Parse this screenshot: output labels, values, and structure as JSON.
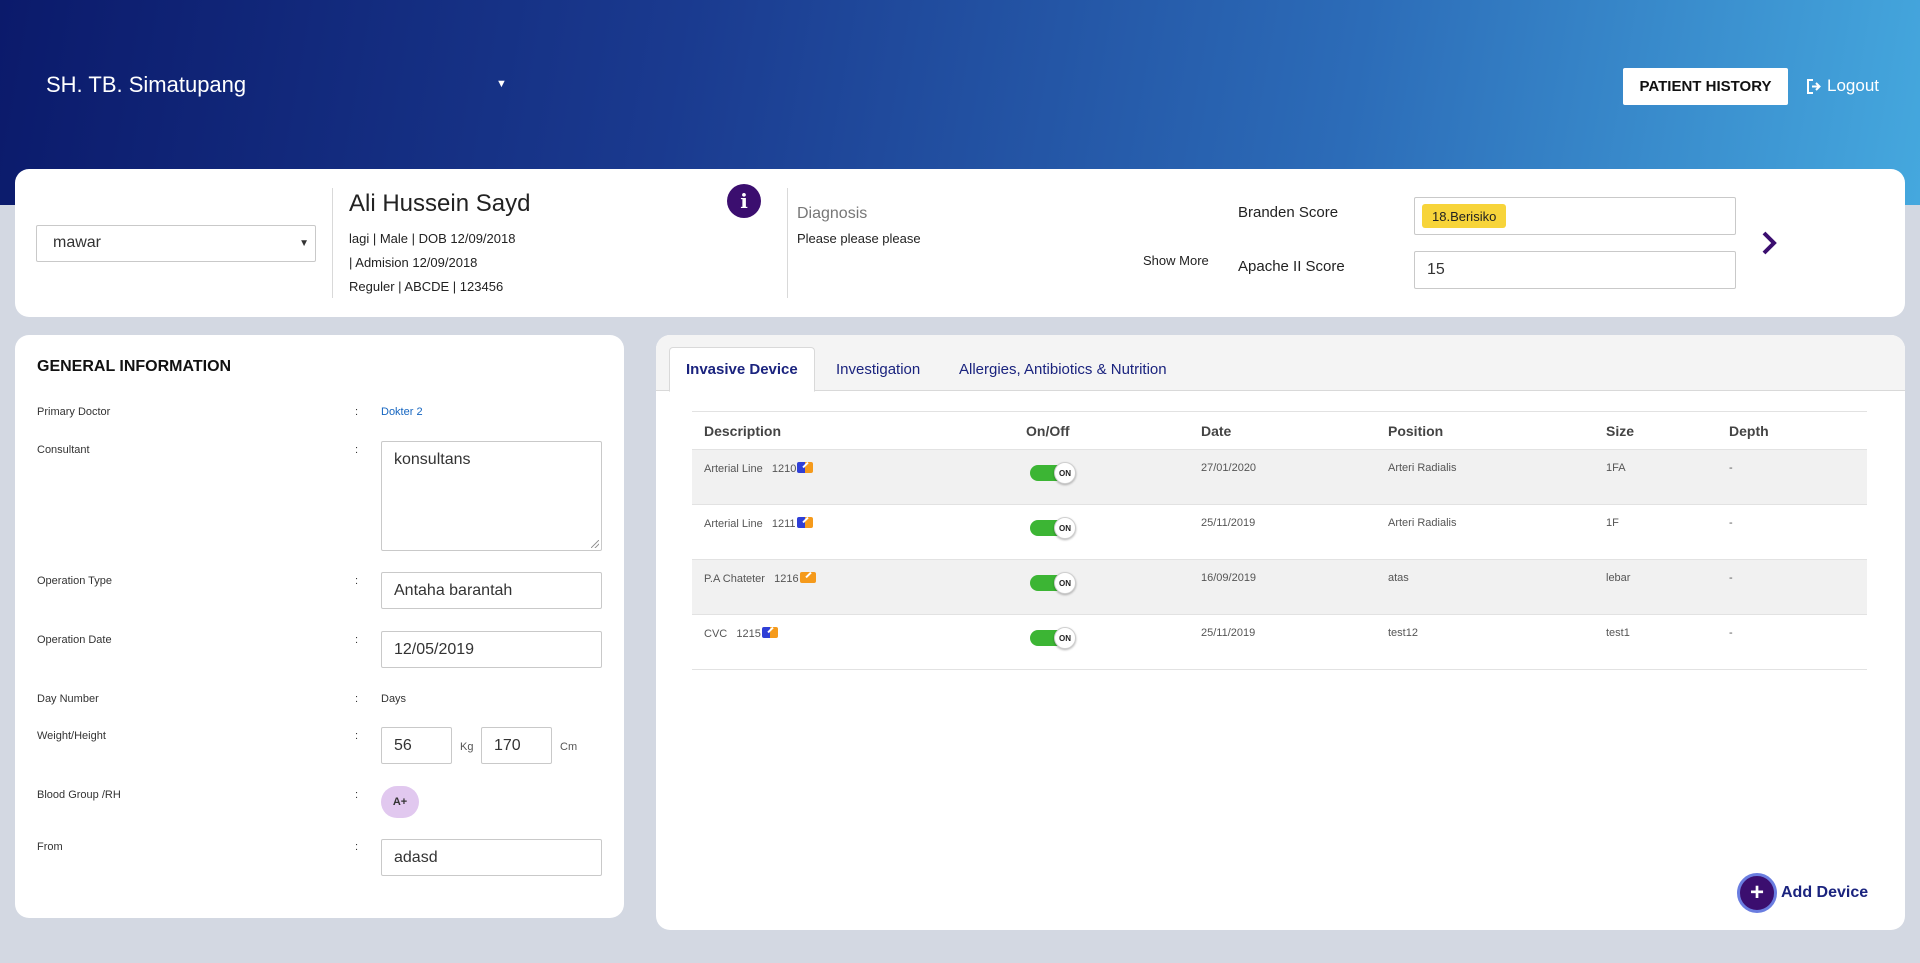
{
  "header": {
    "hospital": "SH. TB. Simatupang",
    "patient_history_label": "PATIENT HISTORY",
    "logout_label": "Logout"
  },
  "patient": {
    "ward": "mawar",
    "name": "Ali Hussein Sayd",
    "line1": "lagi | Male | DOB 12/09/2018",
    "line2": "| Admision 12/09/2018",
    "line3": "Reguler | ABCDE | 123456",
    "diagnosis_title": "Diagnosis",
    "diagnosis_text": "Please please please",
    "show_more_label": "Show More",
    "branden_label": "Branden Score",
    "branden_value": "18.Berisiko",
    "apache_label": "Apache II Score",
    "apache_value": "15"
  },
  "general": {
    "title": "GENERAL INFORMATION",
    "colon": ":",
    "primary_doctor_label": "Primary Doctor",
    "primary_doctor_value": "Dokter 2",
    "consultant_label": "Consultant",
    "consultant_value": "konsultans",
    "operation_type_label": "Operation Type",
    "operation_type_value": "Antaha barantah",
    "operation_date_label": "Operation Date",
    "operation_date_value": "12/05/2019",
    "day_number_label": "Day Number",
    "day_number_value": "Days",
    "weight_height_label": "Weight/Height",
    "weight_value": "56",
    "weight_unit": "Kg",
    "height_value": "170",
    "height_unit": "Cm",
    "blood_group_label": "Blood Group /RH",
    "blood_group_value": "A+",
    "from_label": "From",
    "from_value": "adasd"
  },
  "tabs": [
    "Invasive Device",
    "Investigation",
    "Allergies, Antibiotics & Nutrition"
  ],
  "device_table": {
    "headers": [
      "Description",
      "On/Off",
      "Date",
      "Position",
      "Size",
      "Depth"
    ],
    "toggle_label": "ON",
    "rows": [
      {
        "desc": "Arterial Line",
        "id": "1210",
        "edit_style": "mixed",
        "date": "27/01/2020",
        "position": "Arteri Radialis",
        "size": "1FA",
        "depth": "-"
      },
      {
        "desc": "Arterial Line",
        "id": "1211",
        "edit_style": "mixed",
        "date": "25/11/2019",
        "position": "Arteri Radialis",
        "size": "1F",
        "depth": "-"
      },
      {
        "desc": "P.A Chateter",
        "id": "1216",
        "edit_style": "orange",
        "date": "16/09/2019",
        "position": "atas",
        "size": "lebar",
        "depth": "-"
      },
      {
        "desc": "CVC",
        "id": "1215",
        "edit_style": "mixed",
        "date": "25/11/2019",
        "position": "test12",
        "size": "test1",
        "depth": "-"
      }
    ]
  },
  "add_device": {
    "label": "Add Device",
    "symbol": "+"
  },
  "colors": {
    "accent_purple": "#3b0e6f",
    "link_blue": "#1a237e",
    "toggle_green": "#3cb534",
    "badge_yellow": "#f7d43a"
  }
}
